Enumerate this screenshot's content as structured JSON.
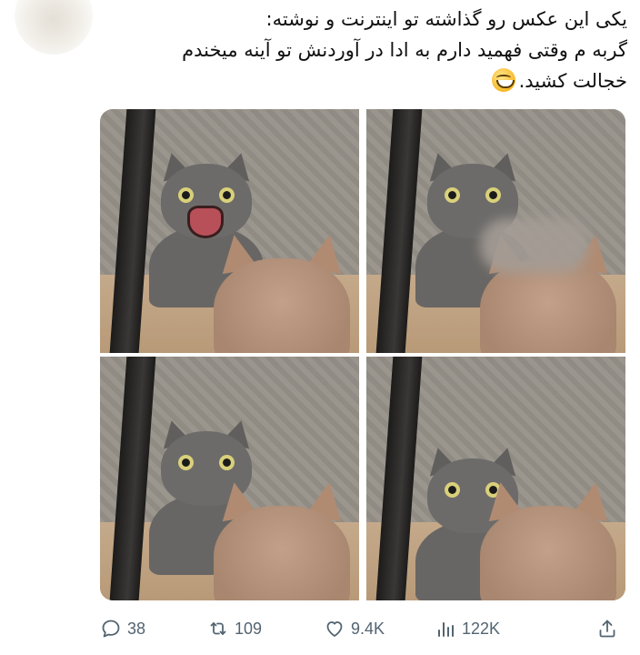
{
  "tweet": {
    "lines": [
      "یکی این عکس رو گذاشته تو اینترنت و نوشته:",
      "گربه م وقتی فهمید دارم به ادا در آوردنش تو آینه میخندم",
      "خجالت کشید."
    ],
    "emoji": "grinning-face-emoji"
  },
  "media": {
    "panels": [
      {
        "name": "panel-1",
        "mirror_cat_mouth": "open"
      },
      {
        "name": "panel-2",
        "censored": true
      },
      {
        "name": "panel-3"
      },
      {
        "name": "panel-4"
      }
    ]
  },
  "actions": {
    "reply_count": "38",
    "retweet_count": "109",
    "like_count": "9.4K",
    "views_count": "122K"
  },
  "colors": {
    "text": "#111111",
    "icon": "#536471",
    "background": "#ffffff"
  }
}
